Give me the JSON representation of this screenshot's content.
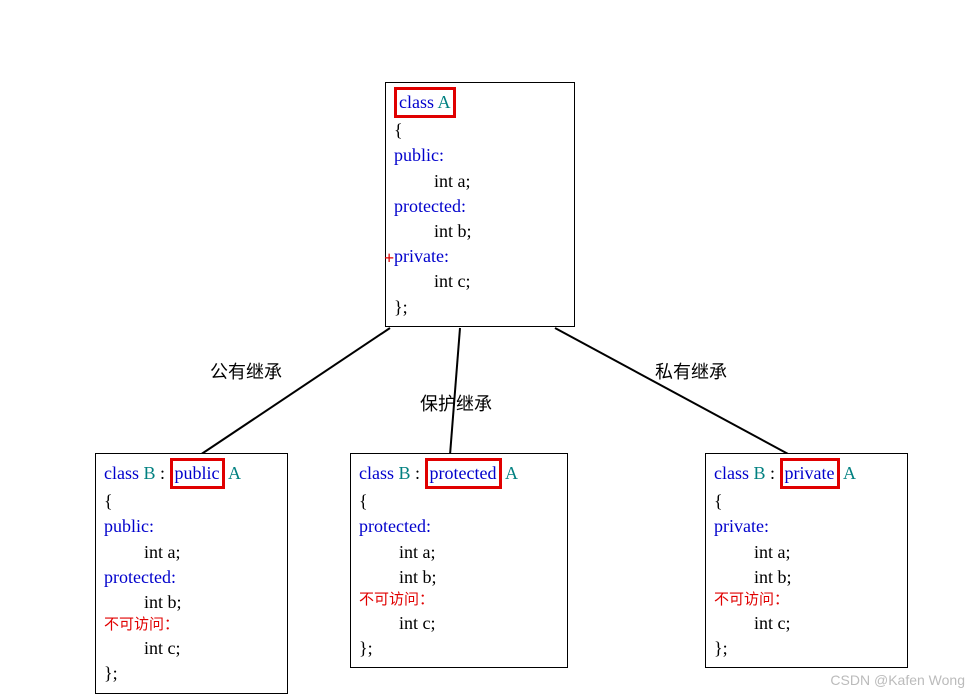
{
  "base": {
    "class_kw": "class",
    "class_name": "A",
    "open": "{",
    "pub": "public:",
    "a": "int a;",
    "prot": "protected:",
    "b": "int b;",
    "priv": "private:",
    "c": "int c;",
    "close": "};"
  },
  "labels": {
    "public_inh": "公有继承",
    "protected_inh": "保护继承",
    "private_inh": "私有继承"
  },
  "pub_child": {
    "class_kw": "class",
    "class_name": "B",
    "colon": " : ",
    "modifier": "public",
    "base": "A",
    "open": "{",
    "sec1": "public:",
    "a": "int a;",
    "sec2": "protected:",
    "b": "int b;",
    "nocan": "不可访问：",
    "c": "int c;",
    "close": "};"
  },
  "prot_child": {
    "class_kw": "class",
    "class_name": "B",
    "colon": " : ",
    "modifier": "protected",
    "base": "A",
    "open": "{",
    "sec1": "protected:",
    "a": "int a;",
    "b": "int b;",
    "nocan": "不可访问：",
    "c": "int c;",
    "close": "};"
  },
  "priv_child": {
    "class_kw": "class",
    "class_name": "B",
    "colon": " : ",
    "modifier": "private",
    "base": "A",
    "open": "{",
    "sec1": "private:",
    "a": "int a;",
    "b": "int b;",
    "nocan": "不可访问：",
    "c": "int c;",
    "close": "};"
  },
  "plus_sign": "+",
  "watermark": "CSDN @Kafen Wong"
}
